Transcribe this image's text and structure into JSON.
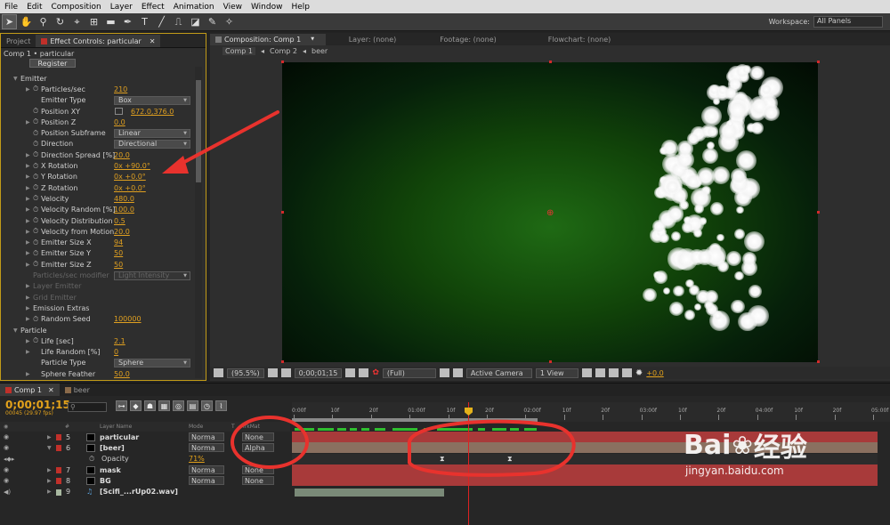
{
  "menu": [
    "File",
    "Edit",
    "Composition",
    "Layer",
    "Effect",
    "Animation",
    "View",
    "Window",
    "Help"
  ],
  "workspace": {
    "label": "Workspace:",
    "value": "All Panels"
  },
  "left_tabs": {
    "project": "Project",
    "effect_controls": "Effect Controls: particular"
  },
  "ec_sub": "Comp 1 • particular",
  "register": "Register",
  "ec_rows": [
    {
      "type": "section",
      "label": "Emitter"
    },
    {
      "type": "val",
      "label": "Particles/sec",
      "value": "210",
      "tri": true,
      "sw": true
    },
    {
      "type": "dd",
      "label": "Emitter Type",
      "value": "Box"
    },
    {
      "type": "pos",
      "label": "Position XY",
      "value": "672.0,376.0",
      "sw": true
    },
    {
      "type": "val",
      "label": "Position Z",
      "value": "0.0",
      "tri": true,
      "sw": true
    },
    {
      "type": "dd",
      "label": "Position Subframe",
      "value": "Linear",
      "sw": true
    },
    {
      "type": "dd",
      "label": "Direction",
      "value": "Directional",
      "sw": true
    },
    {
      "type": "val",
      "label": "Direction Spread [%]",
      "value": "20.0",
      "tri": true,
      "sw": true
    },
    {
      "type": "val",
      "label": "X Rotation",
      "value": "0x +90.0°",
      "tri": true,
      "sw": true
    },
    {
      "type": "val",
      "label": "Y Rotation",
      "value": "0x +0.0°",
      "tri": true,
      "sw": true
    },
    {
      "type": "val",
      "label": "Z Rotation",
      "value": "0x +0.0°",
      "tri": true,
      "sw": true
    },
    {
      "type": "val",
      "label": "Velocity",
      "value": "480.0",
      "tri": true,
      "sw": true
    },
    {
      "type": "val",
      "label": "Velocity Random [%]",
      "value": "100.0",
      "tri": true,
      "sw": true
    },
    {
      "type": "val",
      "label": "Velocity Distribution",
      "value": "0.5",
      "tri": true,
      "sw": true
    },
    {
      "type": "val",
      "label": "Velocity from Motion",
      "value": "20.0",
      "tri": true,
      "sw": true
    },
    {
      "type": "val",
      "label": "Emitter Size X",
      "value": "94",
      "tri": true,
      "sw": true
    },
    {
      "type": "val",
      "label": "Emitter Size Y",
      "value": "50",
      "tri": true,
      "sw": true
    },
    {
      "type": "val",
      "label": "Emitter Size Z",
      "value": "50",
      "tri": true,
      "sw": true
    },
    {
      "type": "dim",
      "label": "Particles/sec modifier",
      "value": "Light Intensity"
    },
    {
      "type": "dimsec",
      "label": "Layer Emitter"
    },
    {
      "type": "dimsec",
      "label": "Grid Emitter"
    },
    {
      "type": "subsec",
      "label": "Emission Extras"
    },
    {
      "type": "val",
      "label": "Random Seed",
      "value": "100000",
      "tri": true,
      "sw": true
    },
    {
      "type": "section",
      "label": "Particle"
    },
    {
      "type": "val",
      "label": "Life [sec]",
      "value": "2.1",
      "tri": true,
      "sw": true
    },
    {
      "type": "val",
      "label": "Life Random [%]",
      "value": "0",
      "tri": true,
      "sw": false
    },
    {
      "type": "dd",
      "label": "Particle Type",
      "value": "Sphere"
    },
    {
      "type": "val",
      "label": "Sphere Feather",
      "value": "50.0",
      "tri": true,
      "sw": false
    }
  ],
  "comp_tabs": {
    "composition": "Composition: Comp 1",
    "layer": "Layer: (none)",
    "footage": "Footage: (none)",
    "flowchart": "Flowchart: (none)"
  },
  "breadcrumb": [
    "Comp 1",
    "Comp 2",
    "beer"
  ],
  "viewer_bar": {
    "zoom": "(95.5%)",
    "timecode": "0;00;01;15",
    "resolution": "(Full)",
    "camera": "Active Camera",
    "views": "1 View",
    "exposure": "+0.0"
  },
  "timeline": {
    "tabs": [
      "Comp 1",
      "beer"
    ],
    "timecode": "0;00;01;15",
    "fps": "00045 (29.97 fps)",
    "col_headers": {
      "layer_name": "Layer Name",
      "mode": "Mode",
      "t": "T",
      "trkmat": "TrkMat"
    },
    "ruler": [
      "0:00f",
      "10f",
      "20f",
      "01:00f",
      "10f",
      "20f",
      "02:00f",
      "10f",
      "20f",
      "03:00f",
      "10f",
      "20f",
      "04:00f",
      "10f",
      "20f",
      "05:00f"
    ],
    "layers": [
      {
        "num": "5",
        "name": "particular",
        "mode": "Norma",
        "trk": "None",
        "color": "#c0302a"
      },
      {
        "num": "6",
        "name": "[beer]",
        "mode": "Norma",
        "trk": "Alpha",
        "color": "#c0302a"
      },
      {
        "num": "",
        "name": "Opacity",
        "mode": "",
        "trk": "",
        "value": "71%",
        "color": ""
      },
      {
        "num": "7",
        "name": "mask",
        "mode": "Norma",
        "trk": "None",
        "color": "#c0302a"
      },
      {
        "num": "8",
        "name": "BG",
        "mode": "Norma",
        "trk": "None",
        "color": "#c0302a"
      },
      {
        "num": "9",
        "name": "[Scifi_...rUp02.wav]",
        "mode": "",
        "trk": "",
        "color": "#a8b8a0"
      }
    ]
  },
  "watermark": {
    "brand": "Bai",
    "brand_cn": "经验",
    "url": "jingyan.baidu.com"
  },
  "colors": {
    "accent": "#e3a21b",
    "annotation": "#e8322d",
    "layer_bar": "#b03a3a",
    "keyframe_green": "#2fbf2f"
  }
}
